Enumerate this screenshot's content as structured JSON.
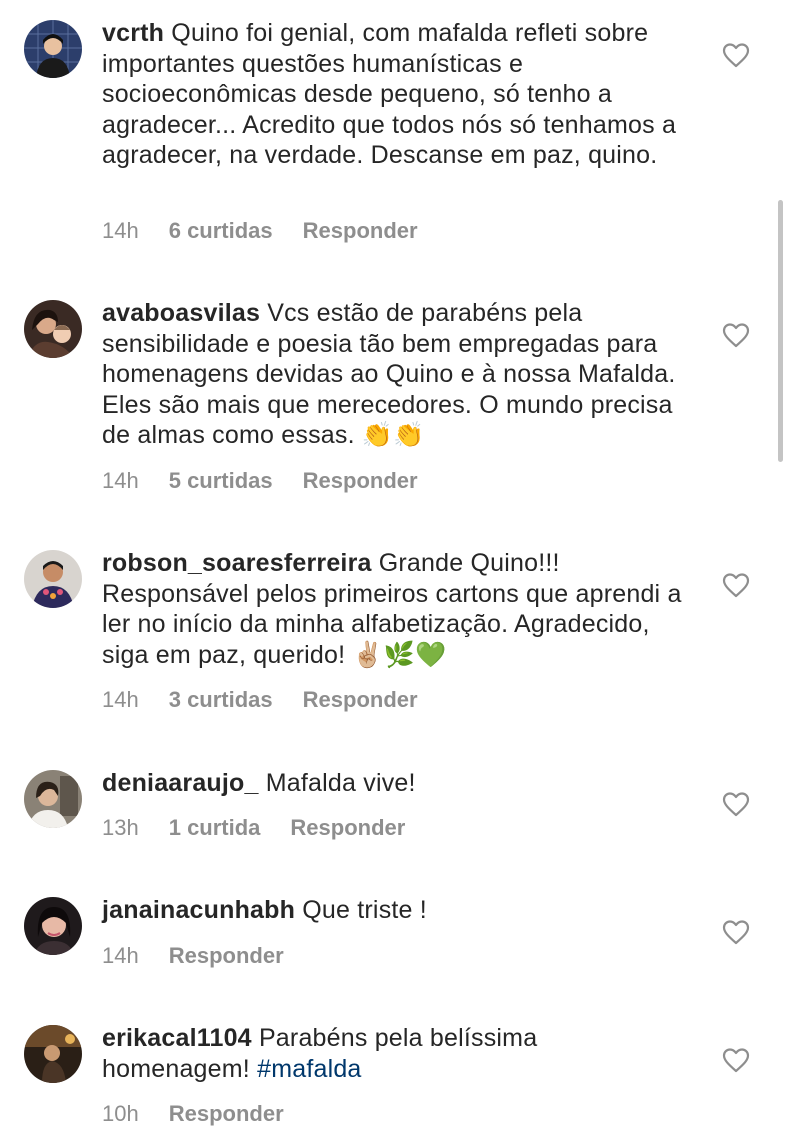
{
  "comments": [
    {
      "username": "vcrth",
      "text": "Quino foi genial, com mafalda refleti sobre importantes questões humanísticas e socioeconômicas desde pequeno, só tenho a agradecer... Acredito que todos nós só tenhamos a agradecer, na verdade. Descanse em paz, quino.",
      "time": "14h",
      "likes": "6 curtidas",
      "reply": "Responder"
    },
    {
      "username": "avaboasvilas",
      "text": "Vcs estão de parabéns pela sensibilidade e poesia tão bem empregadas para homenagens devidas ao Quino e à nossa Mafalda. Eles são mais que merecedores. O mundo precisa de almas como essas. 👏👏",
      "time": "14h",
      "likes": "5 curtidas",
      "reply": "Responder"
    },
    {
      "username": "robson_soaresferreira",
      "text": "Grande Quino!!! Responsável pelos primeiros cartons que aprendi a ler no início da minha alfabetização. Agradecido, siga em paz, querido! ✌🏼🌿💚",
      "time": "14h",
      "likes": "3 curtidas",
      "reply": "Responder"
    },
    {
      "username": "deniaaraujo_",
      "text": "Mafalda vive!",
      "time": "13h",
      "likes": "1 curtida",
      "reply": "Responder"
    },
    {
      "username": "janainacunhabh",
      "text": "Que triste !",
      "time": "14h",
      "likes": "",
      "reply": "Responder"
    },
    {
      "username": "erikacal1104",
      "text": "Parabéns pela belíssima homenagem!",
      "hashtag": "#mafalda",
      "time": "10h",
      "likes": "",
      "reply": "Responder"
    }
  ],
  "icons": {
    "like": "heart-outline-icon"
  },
  "colors": {
    "text": "#262626",
    "meta": "#8e8e8e",
    "hashtag": "#00376b",
    "heart": "#8e8e8e"
  }
}
